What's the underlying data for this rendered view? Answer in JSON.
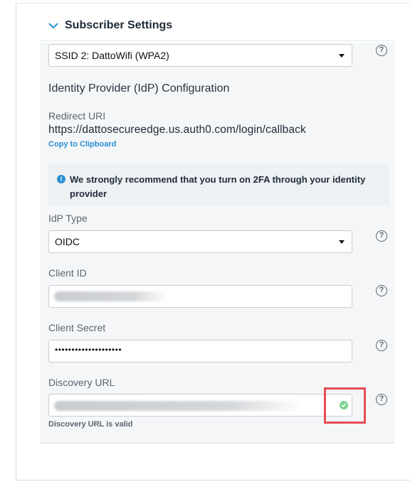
{
  "header": {
    "title": "Subscriber Settings"
  },
  "ssid_select": {
    "value": "SSID 2: DattoWifi (WPA2)"
  },
  "idp_config": {
    "section_title": "Identity Provider (IdP) Configuration",
    "redirect_label": "Redirect URI",
    "redirect_uri": "https://dattosecureedge.us.auth0.com/login/callback",
    "copy_label": "Copy to Clipboard"
  },
  "notice": {
    "icon": "!",
    "text": "We strongly recommend that you turn on 2FA through your identity provider"
  },
  "idp_type": {
    "label": "IdP Type",
    "value": "OIDC"
  },
  "client_id": {
    "label": "Client ID"
  },
  "client_secret": {
    "label": "Client Secret",
    "value": "••••••••••••••••••••"
  },
  "discovery_url": {
    "label": "Discovery URL",
    "status_text": "Discovery URL is valid"
  },
  "help_glyph": "?",
  "colors": {
    "accent": "#2b8fd1",
    "valid": "#7bd38f",
    "highlight": "#e74c55"
  }
}
